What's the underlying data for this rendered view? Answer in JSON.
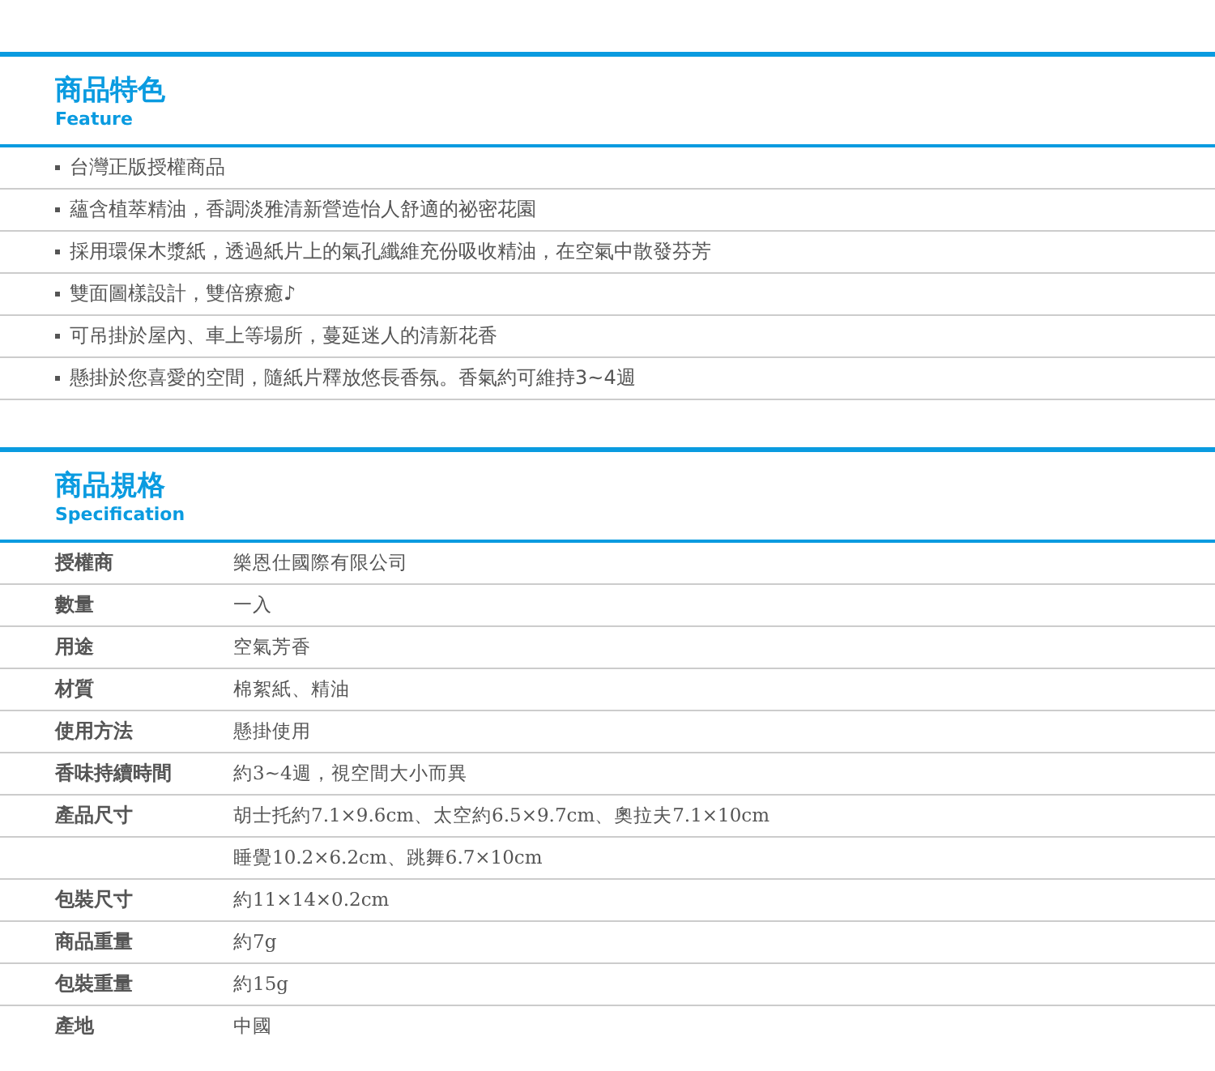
{
  "feature": {
    "title": "商品特色",
    "subtitle": "Feature",
    "items": [
      "台灣正版授權商品",
      "蘊含植萃精油，香調淡雅清新營造怡人舒適的祕密花園",
      "採用環保木漿紙，透過紙片上的氣孔纖維充份吸收精油，在空氣中散發芬芳",
      "雙面圖樣設計，雙倍療癒♪",
      "可吊掛於屋內、車上等場所，蔓延迷人的清新花香",
      "懸掛於您喜愛的空間，隨紙片釋放悠長香氛。香氣約可維持3~4週"
    ]
  },
  "specification": {
    "title": "商品規格",
    "subtitle": "Specification",
    "rows": [
      {
        "label": "授權商",
        "value": "樂恩仕國際有限公司"
      },
      {
        "label": "數量",
        "value": "一入"
      },
      {
        "label": "用途",
        "value": "空氣芳香"
      },
      {
        "label": "材質",
        "value": "棉絮紙、精油"
      },
      {
        "label": "使用方法",
        "value": "懸掛使用"
      },
      {
        "label": "香味持續時間",
        "value": "約3~4週，視空間大小而異"
      },
      {
        "label": "產品尺寸",
        "value": "胡士托約7.1×9.6cm、太空約6.5×9.7cm、奧拉夫7.1×10cm"
      },
      {
        "value": "睡覺10.2×6.2cm、跳舞6.7×10cm"
      },
      {
        "label": "包裝尺寸",
        "value": "約11×14×0.2cm"
      },
      {
        "label": "商品重量",
        "value": "約7g"
      },
      {
        "label": "包裝重量",
        "value": "約15g"
      },
      {
        "label": "產地",
        "value": "中國"
      }
    ]
  }
}
